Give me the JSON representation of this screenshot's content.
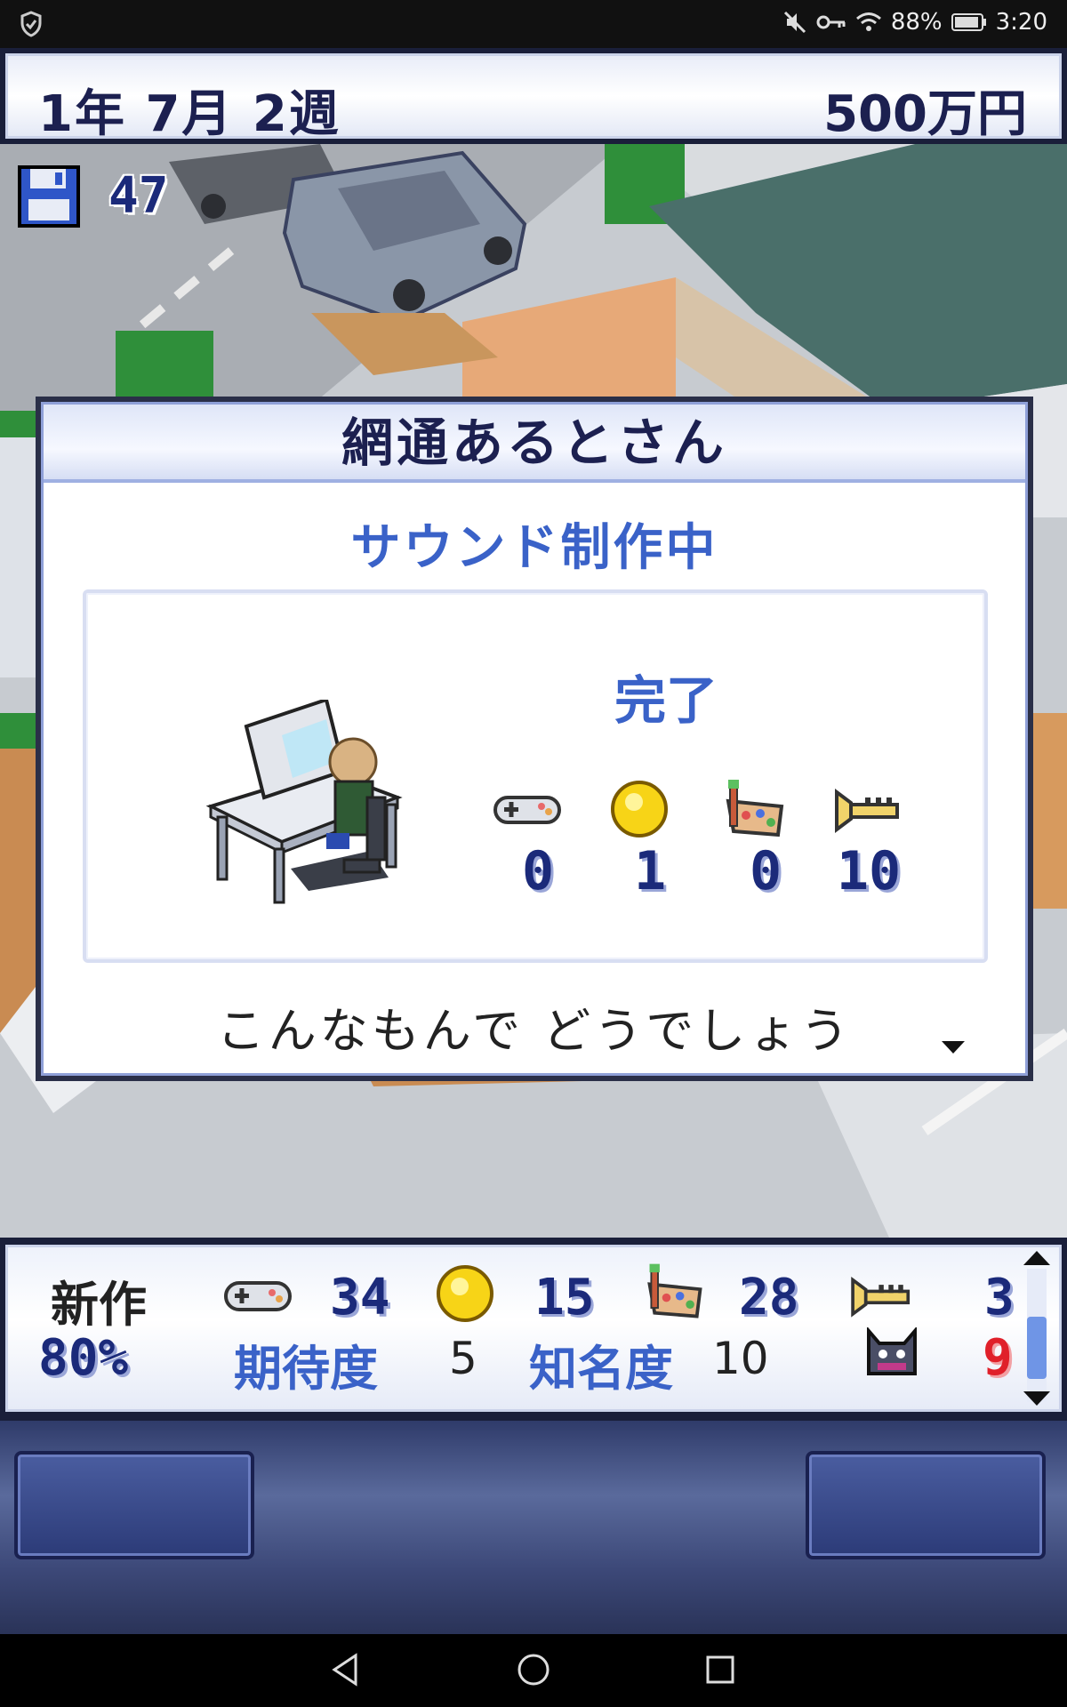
{
  "status_bar": {
    "battery": "88%",
    "time": "3:20",
    "icons": [
      "shield-icon",
      "mute-icon",
      "key-icon",
      "wifi-icon",
      "battery-icon"
    ]
  },
  "top_bar": {
    "date": "1年  7月  2週",
    "money": "500万円"
  },
  "save": {
    "icon": "floppy-disk-icon",
    "count": "47"
  },
  "dialog": {
    "title": "網通あるとさん",
    "subtitle": "サウンド制作中",
    "result_label": "完了",
    "stats": [
      {
        "icon": "controller-icon",
        "value": "0"
      },
      {
        "icon": "gold-coin-icon",
        "value": "1"
      },
      {
        "icon": "paint-palette-icon",
        "value": "0"
      },
      {
        "icon": "trumpet-icon",
        "value": "10"
      }
    ],
    "message": "こんなもんで  どうでしょう",
    "more_indicator": "down-triangle-icon"
  },
  "status_panel": {
    "project_label": "新作",
    "progress": "80%",
    "fun_value": "34",
    "creativity_value": "15",
    "graphics_value": "28",
    "sound_value": "3",
    "bugs_value": "9",
    "expectation_label": "期待度",
    "expectation_value": "5",
    "fame_label": "知名度",
    "fame_value": "10"
  },
  "colors": {
    "accent_blue": "#3a62c8",
    "number_navy": "#1b2a7a",
    "bug_red": "#e0202a"
  }
}
